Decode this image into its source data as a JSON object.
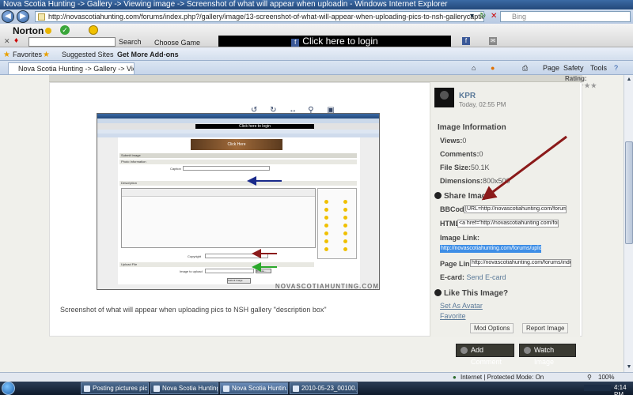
{
  "window": {
    "title": "Nova Scotia Hunting -> Gallery -> Viewing image -> Screenshot of what will appear when uploadin - Windows Internet Explorer"
  },
  "address": {
    "url": "http://novascotiahunting.com/forums/index.php?/gallery/image/13-screenshot-of-what-will-appear-when-uploading-pics-to-nsh-gallerycaption-line/",
    "search_placeholder": "Bing"
  },
  "norton": {
    "logo": "Norton",
    "search_label": "Search",
    "choose_game": "Choose Game",
    "login_banner": "Click here to login"
  },
  "favorites": {
    "favorites_label": "Favorites",
    "suggested_sites": "Suggested Sites",
    "get_more_addons": "Get More Add-ons"
  },
  "tabs": {
    "active": "Nova Scotia Hunting -> Gallery -> Viewing imag...",
    "page_menu": "Page",
    "safety_menu": "Safety",
    "tools_menu": "Tools"
  },
  "content": {
    "rating_label": "Rating:",
    "rating_stars": "★★★★★",
    "caption": "Screenshot of what will appear when uploading pics to NSH gallery \"description box\"",
    "preview": {
      "login": "Click here to login",
      "banner": "Click Here",
      "submit_image": "Submit Image",
      "photo_information": "Photo Information",
      "caption_label": "Caption",
      "description": "Description",
      "copyright": "Copyright",
      "upload_file": "Upload File",
      "image_to_upload": "Image to upload",
      "browse": "Browse...",
      "submit": "Submit Image",
      "watermark": "NOVASCOTIAHUNTING.COM"
    }
  },
  "sidebar": {
    "username": "KPR",
    "date": "Today, 02:55 PM",
    "info_title": "Image Information",
    "views_label": "Views:",
    "views": "0",
    "comments_label": "Comments:",
    "comments": "0",
    "filesize_label": "File Size:",
    "filesize": "50.1K",
    "dimensions_label": "Dimensions:",
    "dimensions": "800x500",
    "share_title": "Share Image",
    "bbcode_label": "BBCode:",
    "bbcode": "[URL=http://novascotiahunting.com/forums/index",
    "html_label": "HTML:",
    "html": "<a href='http://novascotiahunting.com/forums/in",
    "imagelink_label": "Image Link:",
    "imagelink": "http://novascotiahunting.com/forums/uploads/1",
    "pagelink_label": "Page Link:",
    "pagelink": "http://novascotiahunting.com/forums/index.php",
    "ecard_label": "E-card:",
    "send_ecard": "Send E-card",
    "like_title": "Like This Image?",
    "set_avatar": "Set As Avatar",
    "favorite": "Favorite",
    "mod_options": "Mod Options",
    "report_image": "Report Image"
  },
  "actions": {
    "add_comment": "Add Comment",
    "watch_image": "Watch Image"
  },
  "status": {
    "zone": "Internet | Protected Mode: On",
    "zoom": "100%"
  },
  "taskbar": {
    "items": [
      "Posting pictures pic...",
      "Nova Scotia Hunting...",
      "Nova Scotia Huntin...",
      "2010-05-23_00100.jp..."
    ],
    "clock": "4:14 PM"
  }
}
